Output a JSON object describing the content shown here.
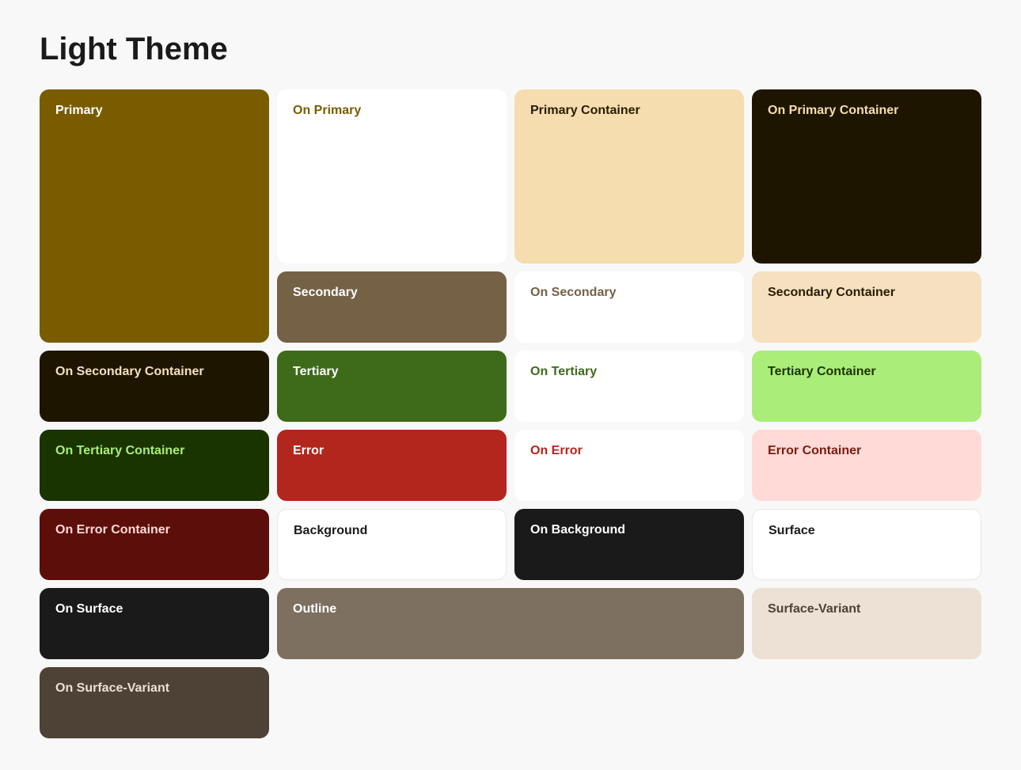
{
  "title": "Light Theme",
  "cells": {
    "primary": "Primary",
    "on_primary": "On Primary",
    "primary_container": "Primary Container",
    "on_primary_container": "On Primary Container",
    "secondary": "Secondary",
    "on_secondary": "On Secondary",
    "secondary_container": "Secondary Container",
    "on_secondary_container": "On Secondary Container",
    "tertiary": "Tertiary",
    "on_tertiary": "On Tertiary",
    "tertiary_container": "Tertiary Container",
    "on_tertiary_container": "On Tertiary Container",
    "error": "Error",
    "on_error": "On Error",
    "error_container": "Error Container",
    "on_error_container": "On Error Container",
    "background": "Background",
    "on_background": "On Background",
    "surface": "Surface",
    "on_surface": "On Surface",
    "outline": "Outline",
    "surface_variant": "Surface-Variant",
    "on_surface_variant": "On Surface-Variant"
  }
}
